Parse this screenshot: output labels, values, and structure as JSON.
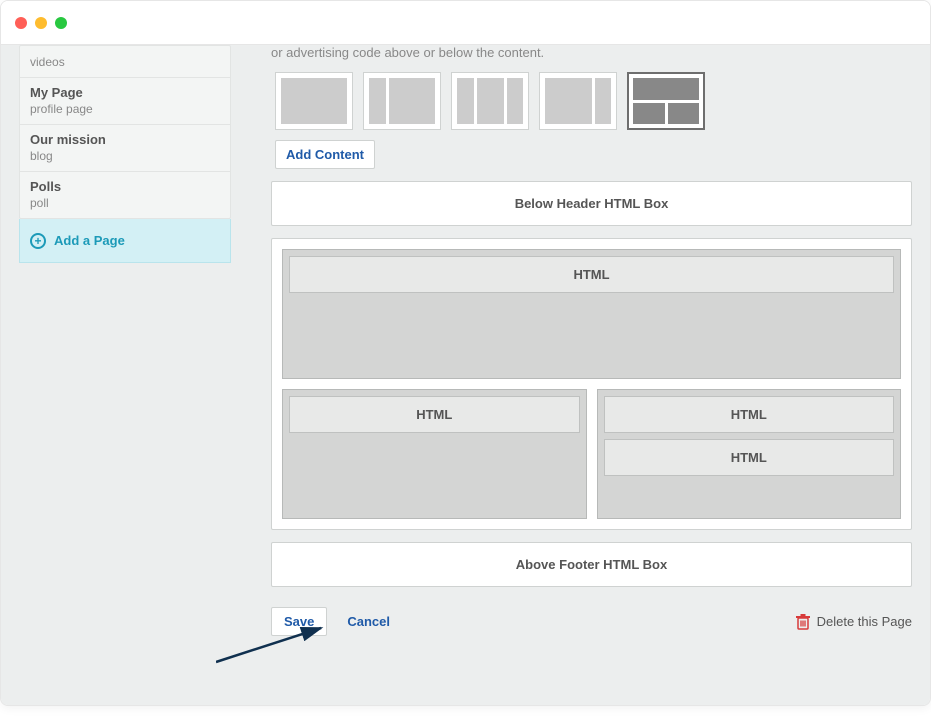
{
  "sidebar": {
    "items": [
      {
        "title": "",
        "sub": "videos"
      },
      {
        "title": "My Page",
        "sub": "profile page"
      },
      {
        "title": "Our mission",
        "sub": "blog"
      },
      {
        "title": "Polls",
        "sub": "poll"
      }
    ],
    "add_label": "Add a Page"
  },
  "main": {
    "truncated_text": "or advertising code above or below the content.",
    "add_content": "Add Content",
    "below_header": "Below Header HTML Box",
    "above_footer": "Above Footer HTML Box",
    "html_label": "HTML"
  },
  "actions": {
    "save": "Save",
    "cancel": "Cancel",
    "delete": "Delete this Page"
  }
}
